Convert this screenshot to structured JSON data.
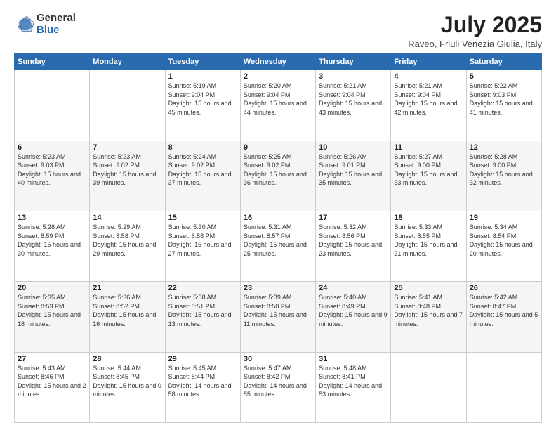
{
  "logo": {
    "general": "General",
    "blue": "Blue"
  },
  "header": {
    "month": "July 2025",
    "location": "Raveo, Friuli Venezia Giulia, Italy"
  },
  "days_of_week": [
    "Sunday",
    "Monday",
    "Tuesday",
    "Wednesday",
    "Thursday",
    "Friday",
    "Saturday"
  ],
  "weeks": [
    [
      {
        "day": "",
        "info": ""
      },
      {
        "day": "",
        "info": ""
      },
      {
        "day": "1",
        "info": "Sunrise: 5:19 AM\nSunset: 9:04 PM\nDaylight: 15 hours and 45 minutes."
      },
      {
        "day": "2",
        "info": "Sunrise: 5:20 AM\nSunset: 9:04 PM\nDaylight: 15 hours and 44 minutes."
      },
      {
        "day": "3",
        "info": "Sunrise: 5:21 AM\nSunset: 9:04 PM\nDaylight: 15 hours and 43 minutes."
      },
      {
        "day": "4",
        "info": "Sunrise: 5:21 AM\nSunset: 9:04 PM\nDaylight: 15 hours and 42 minutes."
      },
      {
        "day": "5",
        "info": "Sunrise: 5:22 AM\nSunset: 9:03 PM\nDaylight: 15 hours and 41 minutes."
      }
    ],
    [
      {
        "day": "6",
        "info": "Sunrise: 5:23 AM\nSunset: 9:03 PM\nDaylight: 15 hours and 40 minutes."
      },
      {
        "day": "7",
        "info": "Sunrise: 5:23 AM\nSunset: 9:02 PM\nDaylight: 15 hours and 39 minutes."
      },
      {
        "day": "8",
        "info": "Sunrise: 5:24 AM\nSunset: 9:02 PM\nDaylight: 15 hours and 37 minutes."
      },
      {
        "day": "9",
        "info": "Sunrise: 5:25 AM\nSunset: 9:02 PM\nDaylight: 15 hours and 36 minutes."
      },
      {
        "day": "10",
        "info": "Sunrise: 5:26 AM\nSunset: 9:01 PM\nDaylight: 15 hours and 35 minutes."
      },
      {
        "day": "11",
        "info": "Sunrise: 5:27 AM\nSunset: 9:00 PM\nDaylight: 15 hours and 33 minutes."
      },
      {
        "day": "12",
        "info": "Sunrise: 5:28 AM\nSunset: 9:00 PM\nDaylight: 15 hours and 32 minutes."
      }
    ],
    [
      {
        "day": "13",
        "info": "Sunrise: 5:28 AM\nSunset: 8:59 PM\nDaylight: 15 hours and 30 minutes."
      },
      {
        "day": "14",
        "info": "Sunrise: 5:29 AM\nSunset: 8:58 PM\nDaylight: 15 hours and 29 minutes."
      },
      {
        "day": "15",
        "info": "Sunrise: 5:30 AM\nSunset: 8:58 PM\nDaylight: 15 hours and 27 minutes."
      },
      {
        "day": "16",
        "info": "Sunrise: 5:31 AM\nSunset: 8:57 PM\nDaylight: 15 hours and 25 minutes."
      },
      {
        "day": "17",
        "info": "Sunrise: 5:32 AM\nSunset: 8:56 PM\nDaylight: 15 hours and 23 minutes."
      },
      {
        "day": "18",
        "info": "Sunrise: 5:33 AM\nSunset: 8:55 PM\nDaylight: 15 hours and 21 minutes."
      },
      {
        "day": "19",
        "info": "Sunrise: 5:34 AM\nSunset: 8:54 PM\nDaylight: 15 hours and 20 minutes."
      }
    ],
    [
      {
        "day": "20",
        "info": "Sunrise: 5:35 AM\nSunset: 8:53 PM\nDaylight: 15 hours and 18 minutes."
      },
      {
        "day": "21",
        "info": "Sunrise: 5:36 AM\nSunset: 8:52 PM\nDaylight: 15 hours and 16 minutes."
      },
      {
        "day": "22",
        "info": "Sunrise: 5:38 AM\nSunset: 8:51 PM\nDaylight: 15 hours and 13 minutes."
      },
      {
        "day": "23",
        "info": "Sunrise: 5:39 AM\nSunset: 8:50 PM\nDaylight: 15 hours and 11 minutes."
      },
      {
        "day": "24",
        "info": "Sunrise: 5:40 AM\nSunset: 8:49 PM\nDaylight: 15 hours and 9 minutes."
      },
      {
        "day": "25",
        "info": "Sunrise: 5:41 AM\nSunset: 8:48 PM\nDaylight: 15 hours and 7 minutes."
      },
      {
        "day": "26",
        "info": "Sunrise: 5:42 AM\nSunset: 8:47 PM\nDaylight: 15 hours and 5 minutes."
      }
    ],
    [
      {
        "day": "27",
        "info": "Sunrise: 5:43 AM\nSunset: 8:46 PM\nDaylight: 15 hours and 2 minutes."
      },
      {
        "day": "28",
        "info": "Sunrise: 5:44 AM\nSunset: 8:45 PM\nDaylight: 15 hours and 0 minutes."
      },
      {
        "day": "29",
        "info": "Sunrise: 5:45 AM\nSunset: 8:44 PM\nDaylight: 14 hours and 58 minutes."
      },
      {
        "day": "30",
        "info": "Sunrise: 5:47 AM\nSunset: 8:42 PM\nDaylight: 14 hours and 55 minutes."
      },
      {
        "day": "31",
        "info": "Sunrise: 5:48 AM\nSunset: 8:41 PM\nDaylight: 14 hours and 53 minutes."
      },
      {
        "day": "",
        "info": ""
      },
      {
        "day": "",
        "info": ""
      }
    ]
  ]
}
